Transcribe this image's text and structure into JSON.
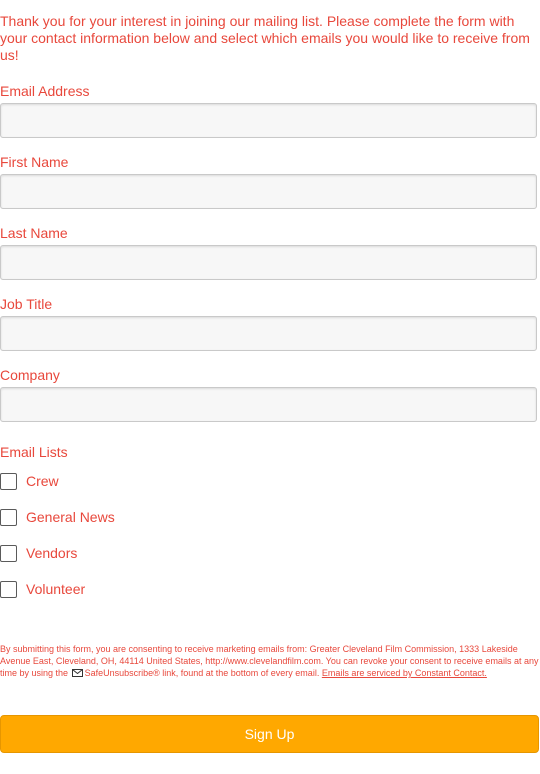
{
  "intro_text": "Thank you for your interest in joining our mailing list. Please complete the form with your contact information below and select which emails you would like to receive from us!",
  "fields": {
    "email": {
      "label": "Email Address",
      "value": ""
    },
    "first_name": {
      "label": "First Name",
      "value": ""
    },
    "last_name": {
      "label": "Last Name",
      "value": ""
    },
    "job_title": {
      "label": "Job Title",
      "value": ""
    },
    "company": {
      "label": "Company",
      "value": ""
    }
  },
  "email_lists": {
    "label": "Email Lists",
    "items": [
      {
        "label": "Crew",
        "checked": false
      },
      {
        "label": "General News",
        "checked": false
      },
      {
        "label": "Vendors",
        "checked": false
      },
      {
        "label": "Volunteer",
        "checked": false
      }
    ]
  },
  "legal": {
    "text_before": "By submitting this form, you are consenting to receive marketing emails from: Greater Cleveland Film Commission, 1333 Lakeside Avenue East, Cleveland, OH, 44114 United States, http://www.clevelandfilm.com. You can revoke your consent to receive emails at any time by using the",
    "safeunsubscribe": "SafeUnsubscribe® link, found at the bottom of every email.",
    "link_text": "Emails are serviced by Constant Contact."
  },
  "submit_label": "Sign Up",
  "colors": {
    "text_accent": "#e8483c",
    "button_bg": "#ffa800",
    "input_bg": "#f7f7f7"
  }
}
